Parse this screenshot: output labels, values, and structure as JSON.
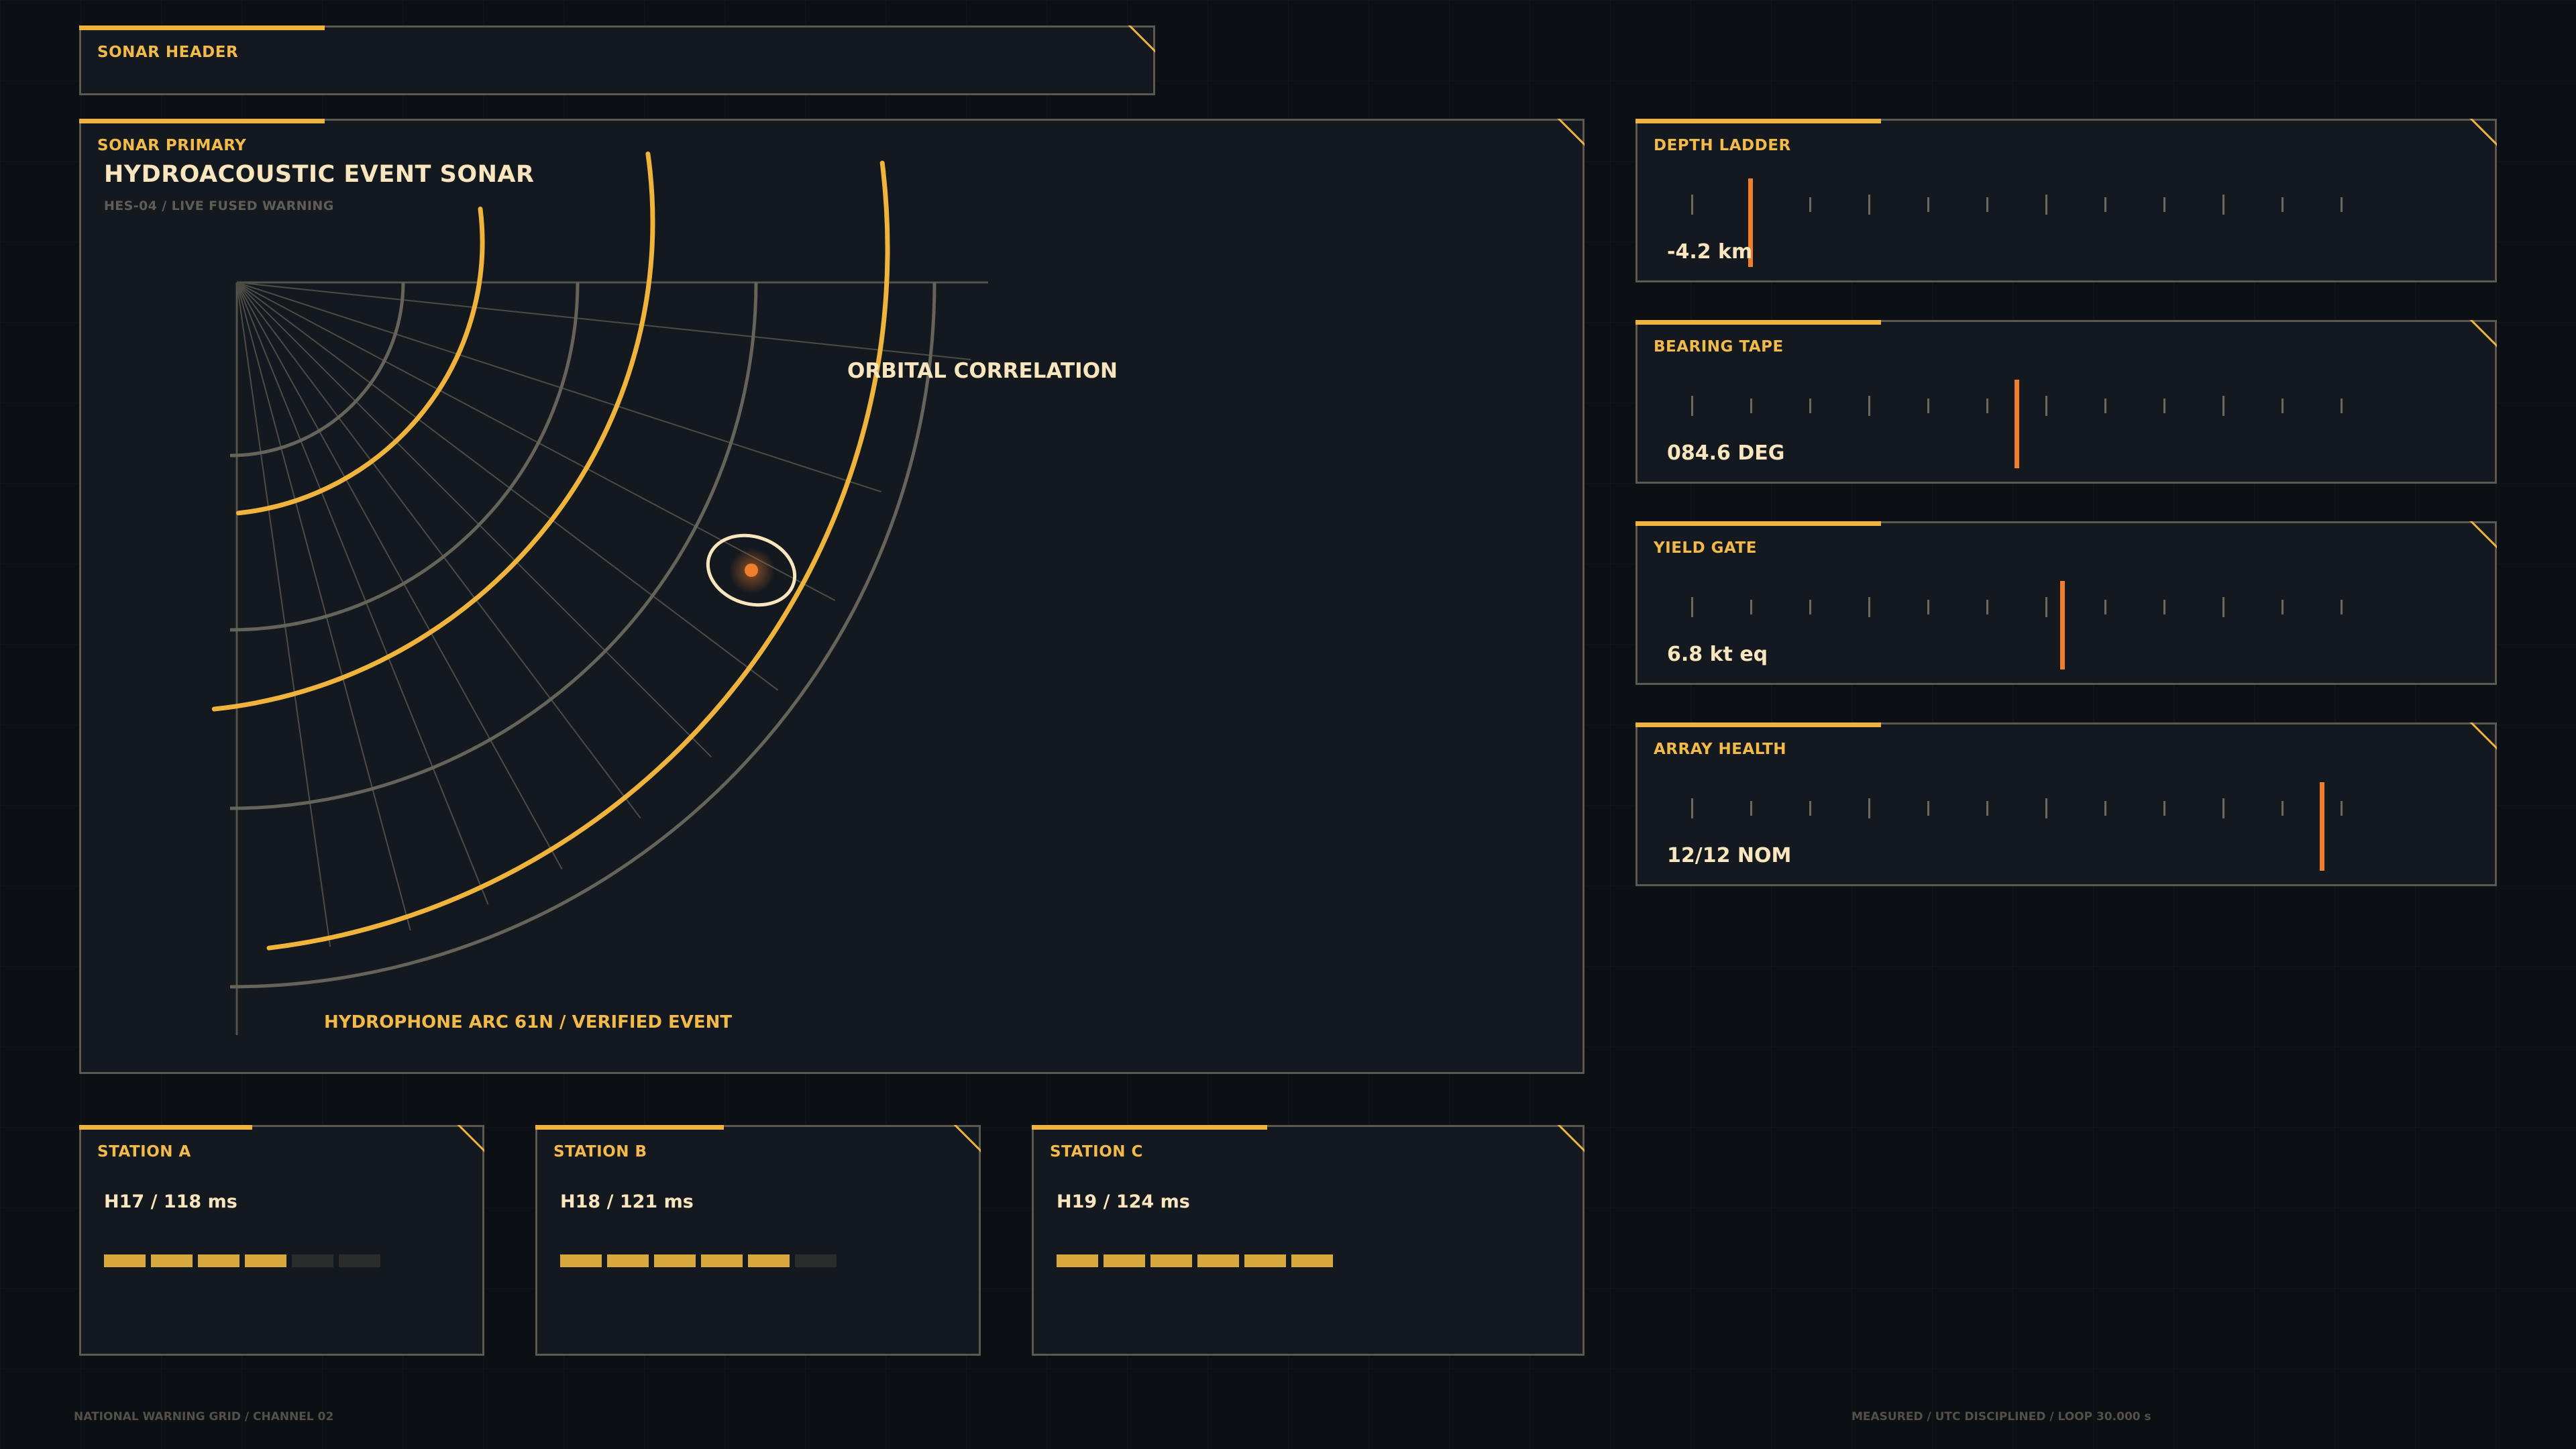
{
  "header": {
    "title": "SONAR HEADER"
  },
  "primary": {
    "panel_title": "SONAR PRIMARY",
    "title": "HYDROACOUSTIC EVENT SONAR",
    "subtitle": "HES-04 / LIVE FUSED WARNING",
    "overlay_label": "ORBITAL CORRELATION",
    "footer_label": "HYDROPHONE ARC 61N / VERIFIED EVENT"
  },
  "gauges": [
    {
      "title": "DEPTH LADDER",
      "value": "-4.2 km",
      "needle_position": 0.09
    },
    {
      "title": "BEARING TAPE",
      "value": "084.6 DEG",
      "needle_position": 0.5
    },
    {
      "title": "YIELD GATE",
      "value": "6.8 kt eq",
      "needle_position": 0.57
    },
    {
      "title": "ARRAY HEALTH",
      "value": "12/12 NOM",
      "needle_position": 0.97
    }
  ],
  "stations": [
    {
      "title": "STATION A",
      "value": "H17 / 118 ms",
      "filled": 4,
      "total": 6
    },
    {
      "title": "STATION B",
      "value": "H18 / 121 ms",
      "filled": 5,
      "total": 6
    },
    {
      "title": "STATION C",
      "value": "H19 / 124 ms",
      "filled": 6,
      "total": 6
    }
  ],
  "footer": {
    "left": "NATIONAL WARNING GRID / CHANNEL 02",
    "right": "MEASURED / UTC DISCIPLINED / LOOP 30.000 s"
  },
  "colors": {
    "accent": "#f0b43c",
    "needle": "#f07e2a",
    "text_primary": "#fae6be",
    "segment_on": "#d8a83c",
    "segment_off": "#2a2d2b"
  }
}
